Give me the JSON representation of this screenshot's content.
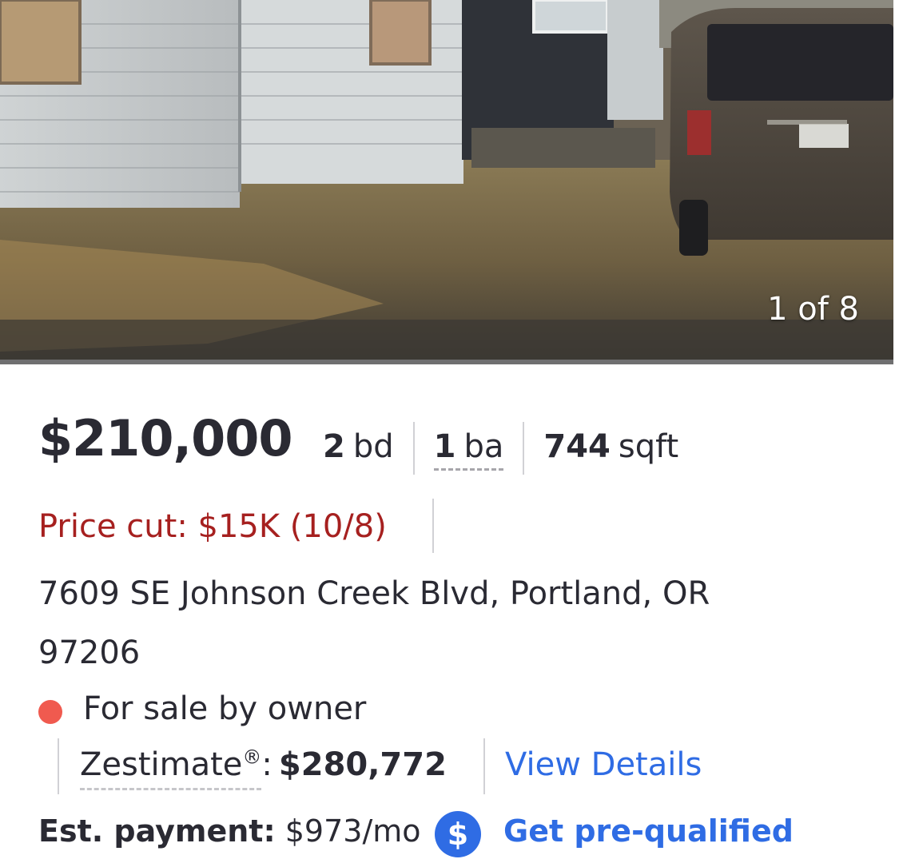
{
  "gallery": {
    "counter": "1 of 8"
  },
  "listing": {
    "price": "$210,000",
    "beds_num": "2",
    "beds_unit": "bd",
    "baths_num": "1",
    "baths_unit": "ba",
    "sqft_num": "744",
    "sqft_unit": "sqft",
    "price_cut": "Price cut: $15K (10/8)",
    "address_line1": "7609 SE Johnson Creek Blvd, Portland, OR",
    "address_line2": "97206",
    "status": "For sale by owner",
    "status_color": "#f05a4f",
    "zestimate_label": "Zestimate",
    "zestimate_mark": "®",
    "zestimate_value": "$280,772",
    "view_details": "View Details",
    "payment_label": "Est. payment:",
    "payment_value": "$973/mo",
    "dollar_icon_glyph": "$",
    "prequalify": "Get pre-qualified",
    "accent_color": "#2f6ce4",
    "price_cut_color": "#a6201f"
  }
}
